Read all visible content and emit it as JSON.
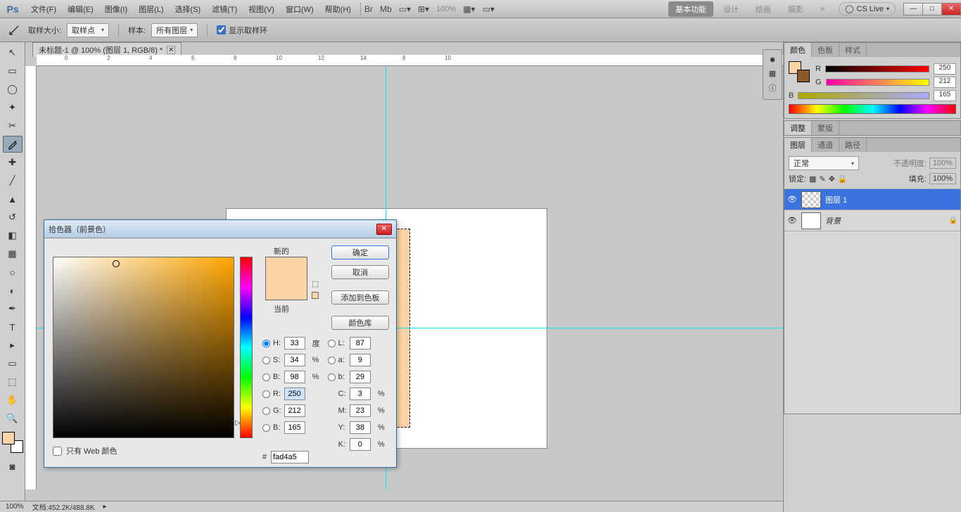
{
  "app": {
    "logo": "Ps"
  },
  "menu": {
    "file": "文件(F)",
    "edit": "编辑(E)",
    "image": "图像(I)",
    "layer": "图层(L)",
    "select": "选择(S)",
    "filter": "滤镜(T)",
    "view": "视图(V)",
    "window": "窗口(W)",
    "help": "帮助(H)",
    "zoom_pct": "100%"
  },
  "workspace": {
    "essentials": "基本功能",
    "design": "设计",
    "painting": "绘画",
    "photography": "摄影",
    "cslive": "CS Live"
  },
  "options": {
    "sample_size_label": "取样大小:",
    "sample_size_value": "取样点",
    "sample_label": "样本:",
    "sample_value": "所有图层",
    "show_ring_label": "显示取样环"
  },
  "doc": {
    "title": "未标题-1 @ 100% (图层 1, RGB/8) *",
    "zoom": "100%",
    "filesize": "文档:452.2K/488.8K"
  },
  "color_panel": {
    "tab_color": "颜色",
    "tab_swatch": "色板",
    "tab_style": "样式",
    "r_label": "R",
    "g_label": "G",
    "b_label": "B",
    "r": "250",
    "g": "212",
    "b": "165"
  },
  "adjust_panel": {
    "tab_adjust": "调整",
    "tab_mask": "蒙版"
  },
  "layers_panel": {
    "tab_layers": "图层",
    "tab_channels": "通道",
    "tab_paths": "路径",
    "blend": "正常",
    "opacity_label": "不透明度:",
    "opacity": "100%",
    "lock_label": "锁定:",
    "fill_label": "填充:",
    "fill": "100%",
    "layer1": "图层 1",
    "bg": "背景"
  },
  "picker": {
    "title": "拾色器（前景色）",
    "new_label": "新的",
    "current_label": "当前",
    "ok": "确定",
    "cancel": "取消",
    "add_swatch": "添加到色板",
    "color_lib": "颜色库",
    "H_label": "H:",
    "H": "33",
    "H_unit": "度",
    "S_label": "S:",
    "S": "34",
    "S_unit": "%",
    "Br_label": "B:",
    "Br": "98",
    "Br_unit": "%",
    "L_label": "L:",
    "L": "87",
    "a_label": "a:",
    "a": "9",
    "lb_label": "b:",
    "lb": "29",
    "R_label": "R:",
    "R": "250",
    "G_label": "G:",
    "G": "212",
    "B_label": "B:",
    "B": "165",
    "C_label": "C:",
    "C": "3",
    "C_unit": "%",
    "M_label": "M:",
    "M": "23",
    "M_unit": "%",
    "Y_label": "Y:",
    "Y": "38",
    "Y_unit": "%",
    "K_label": "K:",
    "K": "0",
    "K_unit": "%",
    "hex_label": "#",
    "hex": "fad4a5",
    "webonly": "只有 Web 颜色"
  }
}
